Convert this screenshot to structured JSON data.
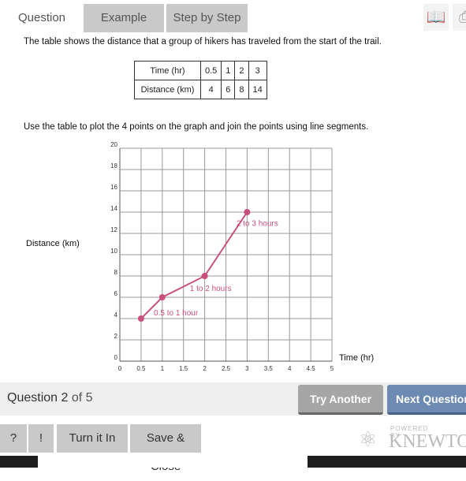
{
  "tabs": [
    {
      "label": "Question",
      "active": true
    },
    {
      "label": "Example",
      "active": false
    },
    {
      "label": "Step by Step",
      "active": false
    }
  ],
  "toolbar_icons": [
    "book-icon",
    "print-icon"
  ],
  "intro": "The table shows the distance that a group of hikers has traveled from the start of the trail.",
  "table": {
    "rows": [
      [
        "Time (hr)",
        "0.5",
        "1",
        "2",
        "3"
      ],
      [
        "Distance (km)",
        "4",
        "6",
        "8",
        "14"
      ]
    ]
  },
  "instruction": "Use the table to plot the 4 points on the graph and join the points using line segments.",
  "chart_data": {
    "type": "line",
    "xlabel": "Time (hr)",
    "ylabel": "Distance (km)",
    "xlim": [
      0,
      5
    ],
    "ylim": [
      0,
      20
    ],
    "xticks": [
      "0",
      "0.5",
      "1",
      "1.5",
      "2",
      "2.5",
      "3",
      "3.5",
      "4",
      "4.5",
      "5"
    ],
    "yticks": [
      "0",
      "2",
      "4",
      "6",
      "8",
      "10",
      "12",
      "14",
      "16",
      "18",
      "20"
    ],
    "grid": true,
    "color": "#c8507f",
    "series": [
      {
        "x": [
          0.5,
          1,
          2,
          3
        ],
        "y": [
          4,
          6,
          8,
          14
        ]
      }
    ],
    "annotations": [
      {
        "text": "0.5 to 1 hour",
        "x": 0.8,
        "y": 4.3
      },
      {
        "text": "1 to 2 hours",
        "x": 1.65,
        "y": 6.6
      },
      {
        "text": "2 to 3 hours",
        "x": 2.75,
        "y": 12.7
      }
    ]
  },
  "footer": {
    "question_prefix": "Question ",
    "question_num": "2",
    "question_suffix": " of 5",
    "try_another": "Try Another",
    "next_question": "Next Question"
  },
  "actions": {
    "help": "?",
    "report": "!",
    "turn_in": "Turn it In",
    "save_close": "Save & Close"
  },
  "branding": {
    "powered_by": "POWERED BY",
    "name": "KNEWTON"
  }
}
